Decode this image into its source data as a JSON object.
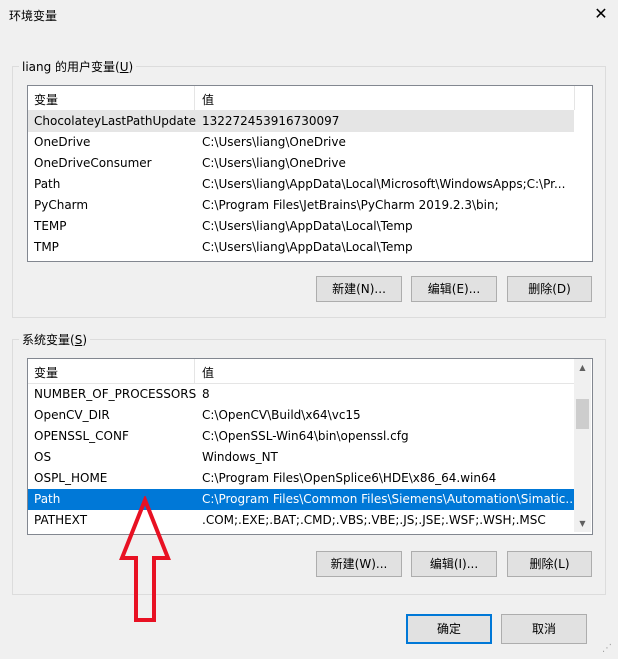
{
  "window": {
    "title": "环境变量"
  },
  "user_vars": {
    "label_prefix": "liang 的用户变量(",
    "label_key": "U",
    "label_suffix": ")",
    "col_var": "变量",
    "col_val": "值",
    "rows": [
      {
        "name": "ChocolateyLastPathUpdate",
        "value": "132272453916730097"
      },
      {
        "name": "OneDrive",
        "value": "C:\\Users\\liang\\OneDrive"
      },
      {
        "name": "OneDriveConsumer",
        "value": "C:\\Users\\liang\\OneDrive"
      },
      {
        "name": "Path",
        "value": "C:\\Users\\liang\\AppData\\Local\\Microsoft\\WindowsApps;C:\\Pr..."
      },
      {
        "name": "PyCharm",
        "value": "C:\\Program Files\\JetBrains\\PyCharm 2019.2.3\\bin;"
      },
      {
        "name": "TEMP",
        "value": "C:\\Users\\liang\\AppData\\Local\\Temp"
      },
      {
        "name": "TMP",
        "value": "C:\\Users\\liang\\AppData\\Local\\Temp"
      }
    ],
    "new_label": "新建(N)...",
    "edit_label": "编辑(E)...",
    "delete_label": "删除(D)"
  },
  "sys_vars": {
    "label_prefix": "系统变量(",
    "label_key": "S",
    "label_suffix": ")",
    "col_var": "变量",
    "col_val": "值",
    "rows": [
      {
        "name": "NUMBER_OF_PROCESSORS",
        "value": "8"
      },
      {
        "name": "OpenCV_DIR",
        "value": "C:\\OpenCV\\Build\\x64\\vc15"
      },
      {
        "name": "OPENSSL_CONF",
        "value": "C:\\OpenSSL-Win64\\bin\\openssl.cfg"
      },
      {
        "name": "OS",
        "value": "Windows_NT"
      },
      {
        "name": "OSPL_HOME",
        "value": "C:\\Program Files\\OpenSplice6\\HDE\\x86_64.win64"
      },
      {
        "name": "Path",
        "value": "C:\\Program Files\\Common Files\\Siemens\\Automation\\Simatic..."
      },
      {
        "name": "PATHEXT",
        "value": ".COM;.EXE;.BAT;.CMD;.VBS;.VBE;.JS;.JSE;.WSF;.WSH;.MSC"
      }
    ],
    "new_label": "新建(W)...",
    "edit_label": "编辑(I)...",
    "delete_label": "删除(L)"
  },
  "footer": {
    "ok_label": "确定",
    "cancel_label": "取消"
  },
  "icons": {
    "close": "close-icon",
    "arrow": "red-up-arrow-annotation"
  },
  "colors": {
    "selection": "#0078d7",
    "annotation": "#e81123"
  }
}
